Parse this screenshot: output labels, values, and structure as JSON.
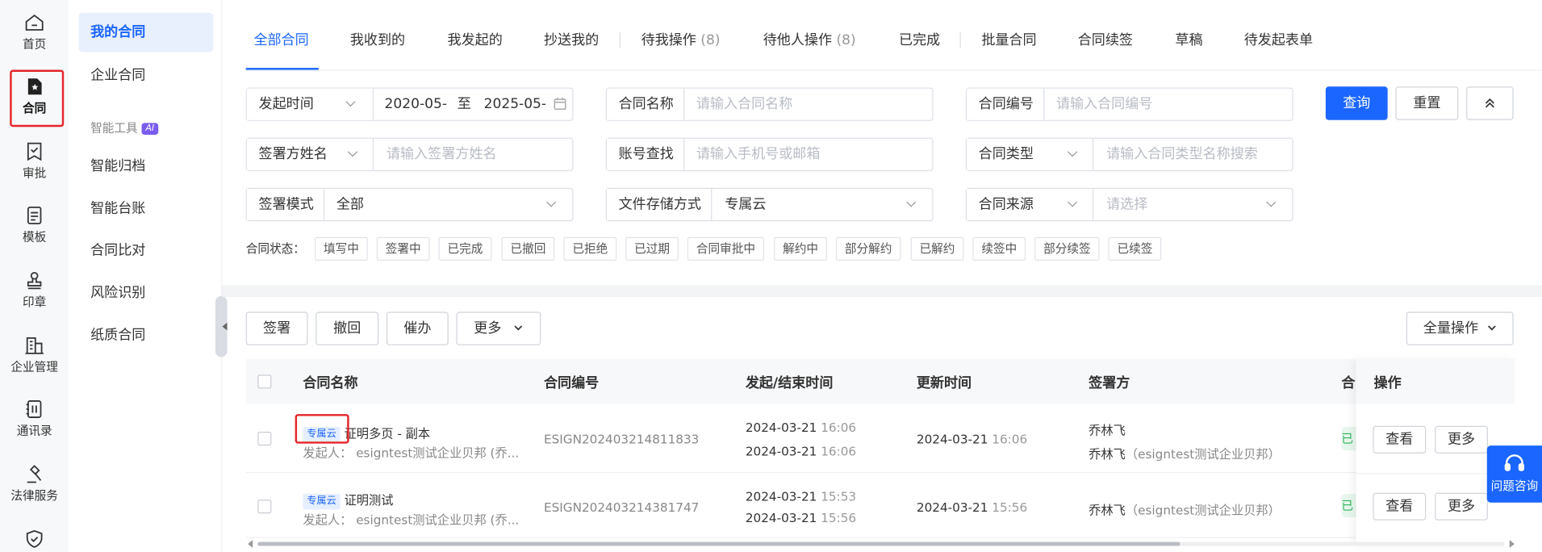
{
  "nav": {
    "items": [
      {
        "label": "首页",
        "icon": "home-icon"
      },
      {
        "label": "合同",
        "icon": "contract-icon"
      },
      {
        "label": "审批",
        "icon": "approval-icon"
      },
      {
        "label": "模板",
        "icon": "template-icon"
      },
      {
        "label": "印章",
        "icon": "seal-icon"
      },
      {
        "label": "企业管理",
        "icon": "enterprise-icon"
      },
      {
        "label": "通讯录",
        "icon": "contacts-icon"
      },
      {
        "label": "法律服务",
        "icon": "legal-icon"
      }
    ]
  },
  "sidebar": {
    "items": [
      "我的合同",
      "企业合同"
    ],
    "group_label": "智能工具",
    "group_badge": "AI",
    "tools": [
      "智能归档",
      "智能台账",
      "合同比对",
      "风险识别",
      "纸质合同"
    ]
  },
  "tabs": {
    "items": [
      "全部合同",
      "我收到的",
      "我发起的",
      "抄送我的",
      "待我操作",
      "待他人操作",
      "已完成",
      "批量合同",
      "合同续签",
      "草稿",
      "待发起表单"
    ],
    "count_todo_me": "(8)",
    "count_todo_others": "(8)"
  },
  "filters": {
    "time_select": "发起时间",
    "date_start": "2020-05-",
    "date_to": "至",
    "date_end": "2025-05-",
    "contract_name_label": "合同名称",
    "contract_name_placeholder": "请输入合同名称",
    "contract_no_label": "合同编号",
    "contract_no_placeholder": "请输入合同编号",
    "signer_select": "签署方姓名",
    "signer_placeholder": "请输入签署方姓名",
    "account_label": "账号查找",
    "account_placeholder": "请输入手机号或邮箱",
    "type_select": "合同类型",
    "type_placeholder": "请输入合同类型名称搜索",
    "mode_label": "签署模式",
    "mode_value": "全部",
    "storage_label": "文件存储方式",
    "storage_value": "专属云",
    "source_select": "合同来源",
    "source_placeholder": "请选择",
    "query": "查询",
    "reset": "重置"
  },
  "status": {
    "label": "合同状态：",
    "chips": [
      "填写中",
      "签署中",
      "已完成",
      "已撤回",
      "已拒绝",
      "已过期",
      "合同审批中",
      "解约中",
      "部分解约",
      "已解约",
      "续签中",
      "部分续签",
      "已续签"
    ]
  },
  "actions": {
    "sign": "签署",
    "revoke": "撤回",
    "urge": "催办",
    "more": "更多",
    "bulk": "全量操作"
  },
  "table": {
    "headers": {
      "name": "合同名称",
      "no": "合同编号",
      "time": "发起/结束时间",
      "updated": "更新时间",
      "party": "签署方",
      "status": "合",
      "ops": "操作"
    },
    "rows": [
      {
        "tag": "专属云",
        "name": "证明多页 - 副本",
        "initiator_label": "发起人：",
        "initiator": "esigntest测试企业贝邦 (乔...",
        "no": "ESIGN202403214811833",
        "start_date": "2024-03-21",
        "start_time": "16:06",
        "end_date": "2024-03-21",
        "end_time": "16:06",
        "updated_date": "2024-03-21",
        "updated_time": "16:06",
        "party1": "乔林飞",
        "party2_name": "乔林飞",
        "party2_org": "（esigntest测试企业贝邦）",
        "status_initial": "已"
      },
      {
        "tag": "专属云",
        "name": "证明测试",
        "initiator_label": "发起人：",
        "initiator": "esigntest测试企业贝邦 (乔...",
        "no": "ESIGN202403214381747",
        "start_date": "2024-03-21",
        "start_time": "15:53",
        "end_date": "2024-03-21",
        "end_time": "15:56",
        "updated_date": "2024-03-21",
        "updated_time": "15:56",
        "party2_name": "乔林飞",
        "party2_org": "（esigntest测试企业贝邦）",
        "status_initial": "已"
      }
    ],
    "view": "查看",
    "more": "更多"
  },
  "float_help": "问题咨询",
  "colors": {
    "primary": "#1a66ff",
    "highlight": "#e5252a",
    "success": "#2db55d"
  }
}
